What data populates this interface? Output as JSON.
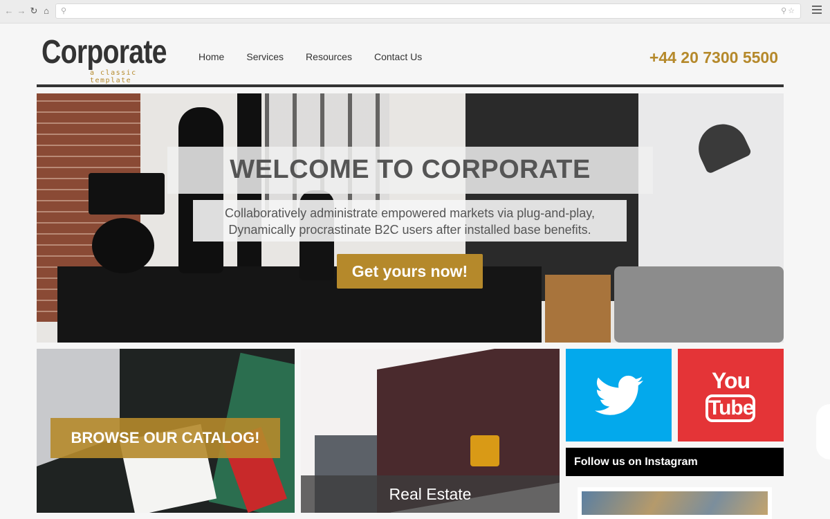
{
  "browser": {
    "back_icon": "back-arrow-icon",
    "forward_icon": "forward-arrow-icon",
    "reload_icon": "reload-icon",
    "home_icon": "home-icon",
    "url": ""
  },
  "header": {
    "logo_text": "Corporate",
    "logo_tagline": "a classic template",
    "nav": [
      "Home",
      "Services",
      "Resources",
      "Contact Us"
    ],
    "phone": "+44 20 7300 5500"
  },
  "hero": {
    "title": "WELCOME TO CORPORATE",
    "subtitle_line1": "Collaboratively administrate empowered markets via plug-and-play,",
    "subtitle_line2": "Dynamically procrastinate B2C users after installed base benefits.",
    "cta": "Get yours now!"
  },
  "tiles": {
    "catalog_button": "BROWSE OUR CATALOG!",
    "realestate_label": "Real Estate"
  },
  "social": {
    "twitter_icon": "twitter-bird-icon",
    "youtube_you": "You",
    "youtube_tube": "Tube",
    "instagram_title": "Follow us on Instagram"
  },
  "colors": {
    "accent": "#b5892b",
    "twitter": "#03a9ec",
    "youtube": "#e43437",
    "dark": "#333333"
  }
}
